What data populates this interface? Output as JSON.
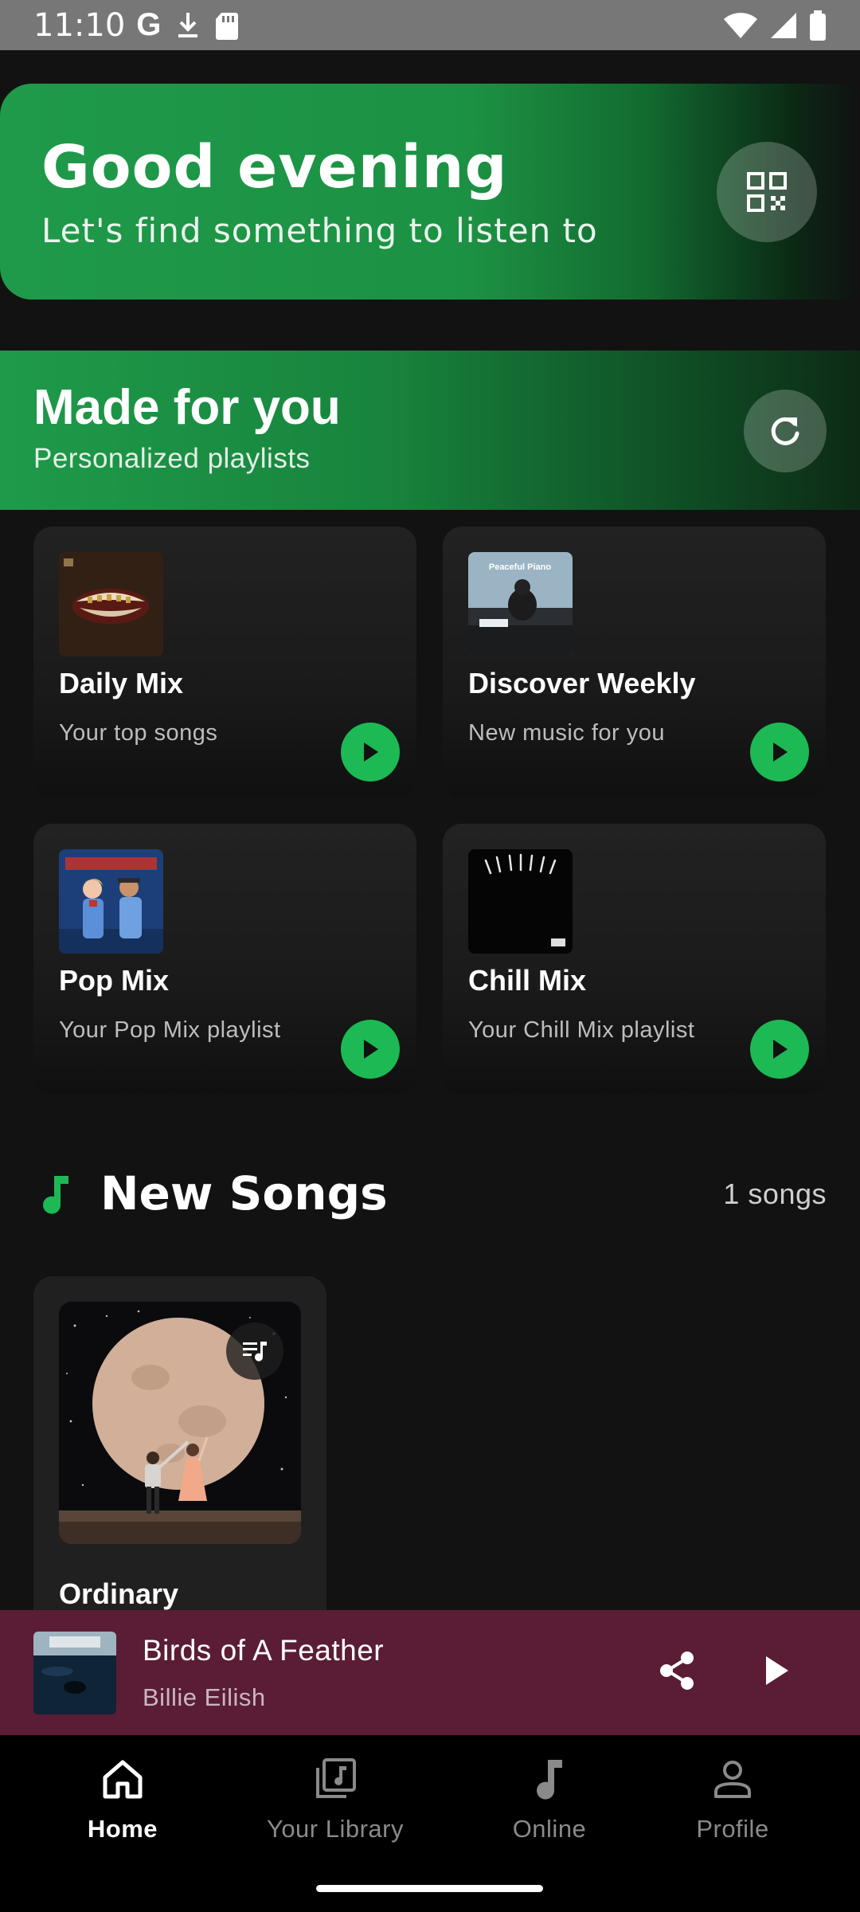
{
  "status_bar": {
    "time": "11:10",
    "icons": [
      "google-icon",
      "download-icon",
      "sd-card-icon",
      "wifi-icon",
      "signal-icon",
      "battery-icon"
    ]
  },
  "greeting": {
    "title": "Good evening",
    "subtitle": "Let's find something to listen to",
    "qr_icon": "qr-code-icon"
  },
  "made_for_you": {
    "title": "Made for you",
    "subtitle": "Personalized playlists",
    "refresh_icon": "refresh-icon",
    "playlists": [
      {
        "name": "Daily Mix",
        "description": "Your top songs"
      },
      {
        "name": "Discover Weekly",
        "description": "New music for you",
        "art_text": "Peaceful Piano"
      },
      {
        "name": "Pop Mix",
        "description": "Your Pop Mix playlist"
      },
      {
        "name": "Chill Mix",
        "description": "Your Chill Mix playlist"
      }
    ]
  },
  "new_songs": {
    "title": "New Songs",
    "count": "1 songs",
    "songs": [
      {
        "title": "Ordinary"
      }
    ]
  },
  "now_playing": {
    "title": "Birds of A Feather",
    "artist": "Billie Eilish"
  },
  "bottom_nav": {
    "items": [
      {
        "label": "Home",
        "icon": "home-icon",
        "active": true
      },
      {
        "label": "Your Library",
        "icon": "library-icon",
        "active": false
      },
      {
        "label": "Online",
        "icon": "music-note-icon",
        "active": false
      },
      {
        "label": "Profile",
        "icon": "profile-icon",
        "active": false
      }
    ]
  },
  "colors": {
    "accent": "#1db954",
    "background": "#121212",
    "mini_player": "#5a1d35"
  }
}
